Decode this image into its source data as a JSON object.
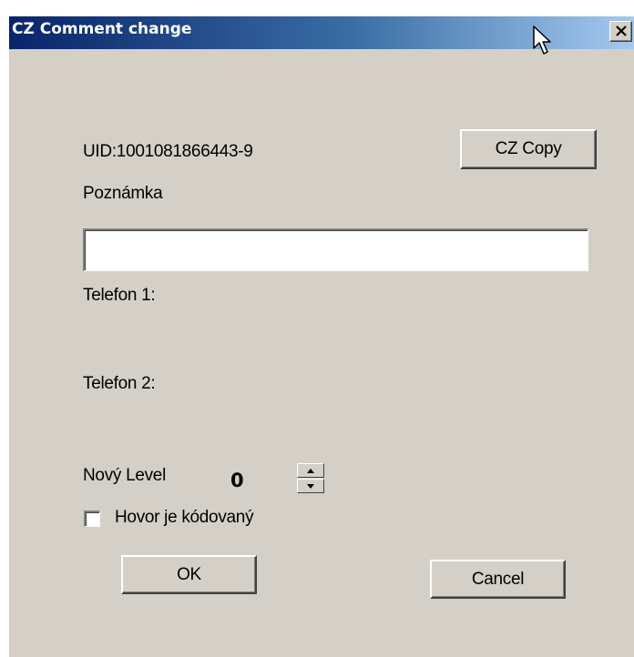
{
  "window": {
    "title": "CZ Comment change",
    "close_glyph": "✕"
  },
  "dialog": {
    "uid_text": "UID:1001081866443-9",
    "copy_button_label": "CZ Copy",
    "note_label": "Poznámka",
    "note_value": "",
    "phone1_label": "Telefon 1:",
    "phone2_label": "Telefon 2:",
    "level_label": "Nový Level",
    "level_value": "0",
    "encoded_label": "Hovor je kódovaný",
    "encoded_checked": false,
    "ok_label": "OK",
    "cancel_label": "Cancel"
  },
  "icons": {
    "close": "close-icon",
    "spin_up": "triangle-up-icon",
    "spin_down": "triangle-down-icon",
    "cursor": "mouse-pointer-icon"
  },
  "colors": {
    "title_start": "#0a246a",
    "title_end": "#a6caf0",
    "face": "#d4d0c8"
  }
}
